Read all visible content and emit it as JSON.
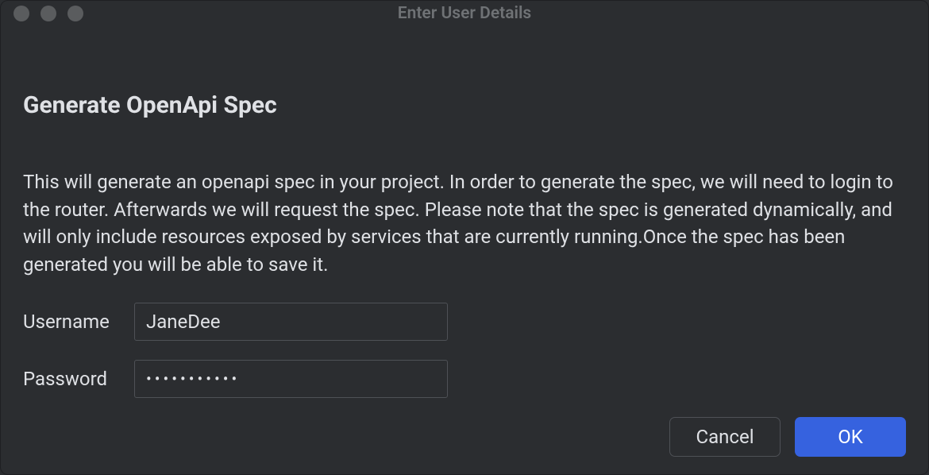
{
  "window": {
    "title": "Enter User Details"
  },
  "dialog": {
    "heading": "Generate OpenApi Spec",
    "description": "This will generate an openapi spec in your project. In order to generate the spec, we will need to login to the router. Afterwards we will request the spec. Please note that the spec is generated dynamically, and will only include resources exposed by services that are currently running.Once the spec has been generated you will be able to save it."
  },
  "form": {
    "username": {
      "label": "Username",
      "value": "JaneDee"
    },
    "password": {
      "label": "Password",
      "value": "•••••••••••"
    }
  },
  "buttons": {
    "cancel": "Cancel",
    "ok": "OK"
  }
}
